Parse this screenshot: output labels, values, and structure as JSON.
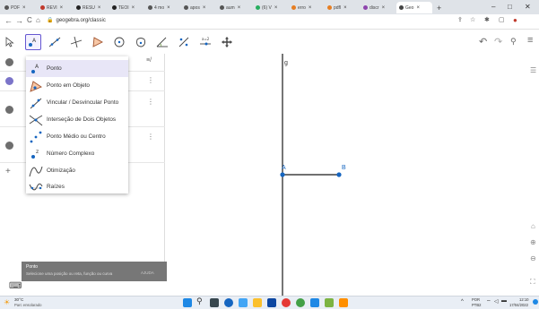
{
  "browser": {
    "tabs": [
      {
        "label": "PDF",
        "color": "#555555"
      },
      {
        "label": "REVI",
        "color": "#c0392b"
      },
      {
        "label": "RESU",
        "color": "#222222"
      },
      {
        "label": "TEOI",
        "color": "#222222"
      },
      {
        "label": "4 mo",
        "color": "#555555"
      },
      {
        "label": "apos",
        "color": "#555555"
      },
      {
        "label": "aum",
        "color": "#555555"
      },
      {
        "label": "(6) V",
        "color": "#27ae60"
      },
      {
        "label": "erro",
        "color": "#e67e22"
      },
      {
        "label": "pdfl",
        "color": "#e67e22"
      },
      {
        "label": "discr",
        "color": "#8e44ad"
      },
      {
        "label": "Geo",
        "color": "#444444"
      }
    ],
    "new_tab": "+",
    "window_controls": {
      "minimize": "–",
      "maximize": "□",
      "close": "✕"
    },
    "url": "geogebra.org/classic",
    "nav": {
      "back": "←",
      "forward": "→",
      "reload": "C",
      "home": "⌂"
    }
  },
  "toolbar": {
    "undo": "↶",
    "redo": "↷",
    "search": "🔍",
    "menu": "≡"
  },
  "algebra": {
    "sort_icon": "≡/",
    "add": "+"
  },
  "tool_menu": {
    "items": [
      {
        "label": "Ponto",
        "selected": true
      },
      {
        "label": "Ponto em Objeto"
      },
      {
        "label": "Vincular / Desvincular Ponto"
      },
      {
        "label": "Interseção de Dois Objetos"
      },
      {
        "label": "Ponto Médio ou Centro"
      },
      {
        "label": "Número Complexo"
      },
      {
        "label": "Otimização"
      },
      {
        "label": "Raízes"
      }
    ]
  },
  "graphics": {
    "line_label": "g",
    "point_a": "A",
    "point_b": "B",
    "colors": {
      "line": "#1a1a1a",
      "point": "#1565c0",
      "segment": "#1a1a1a"
    }
  },
  "toast": {
    "title": "Ponto",
    "text": "Selecione uma posição ou reta, função ou curva",
    "ajuda": "AJUDA"
  },
  "taskbar": {
    "weather_temp": "30°C",
    "weather_desc": "Parc ensolarado",
    "lang": "POR",
    "lang2": "PTB2",
    "time": "12:10",
    "date": "17/04/2022"
  },
  "colors": {
    "accent": "#6557d2",
    "dot_gray": "#6e6e6e",
    "dot_purple": "#7b74c9"
  }
}
